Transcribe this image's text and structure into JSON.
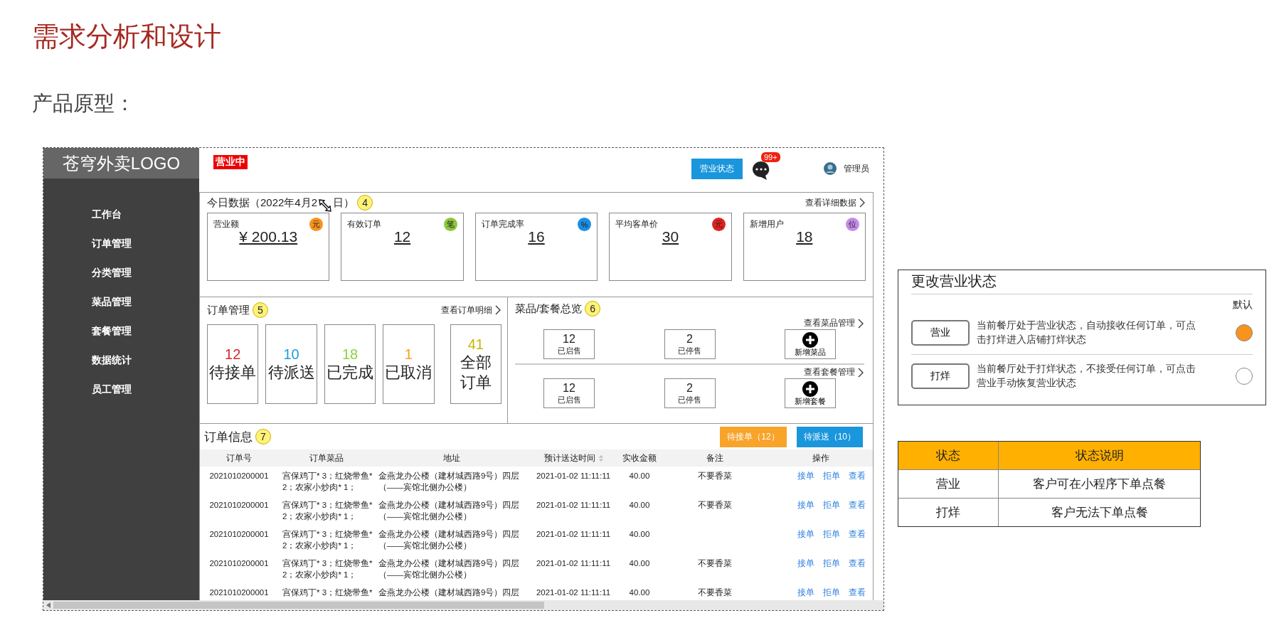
{
  "page_title": "需求分析和设计",
  "subtitle": "产品原型：",
  "prototype": {
    "logo": "苍穹外卖LOGO",
    "sidebar": {
      "items": [
        "工作台",
        "订单管理",
        "分类管理",
        "菜品管理",
        "套餐管理",
        "数据统计",
        "员工管理"
      ]
    },
    "header": {
      "status_badge": "营业中",
      "status_button": "营业状态",
      "message_count": "99+",
      "user": "管理员"
    },
    "today_data": {
      "title_start": "今日数据（2022年4月2",
      "title_end": "日）",
      "badge": "4",
      "link": "查看详细数据",
      "cards": [
        {
          "label": "营业额",
          "value": "¥ 200.13",
          "icon": "元",
          "color": "#f7931e"
        },
        {
          "label": "有效订单",
          "value": "12",
          "icon": "笔",
          "color": "#8cc63f"
        },
        {
          "label": "订单完成率",
          "value": "16",
          "icon": "%",
          "color": "#1a8fe3"
        },
        {
          "label": "平均客单价",
          "value": "30",
          "icon": "元",
          "color": "#e02020"
        },
        {
          "label": "新增用户",
          "value": "18",
          "icon": "位",
          "color": "#c58be8"
        }
      ]
    },
    "order_management": {
      "title": "订单管理",
      "badge": "5",
      "link": "查看订单明细",
      "statuses": [
        {
          "count": "12",
          "label": "待接单",
          "color": "#d9262c"
        },
        {
          "count": "10",
          "label": "待派送",
          "color": "#1a9ae0"
        },
        {
          "count": "18",
          "label": "已完成",
          "color": "#8cd23c"
        },
        {
          "count": "1",
          "label": "已取消",
          "color": "#f7a11a"
        },
        {
          "count": "41",
          "label": "全部订单",
          "color": "#c8b400"
        }
      ]
    },
    "dish_overview": {
      "title": "菜品/套餐总览",
      "badge": "6",
      "groups": [
        {
          "link": "查看菜品管理",
          "stats": [
            {
              "count": "12",
              "label": "已启售"
            },
            {
              "count": "2",
              "label": "已停售"
            }
          ],
          "add_label": "新增菜品"
        },
        {
          "link": "查看套餐管理",
          "stats": [
            {
              "count": "12",
              "label": "已启售"
            },
            {
              "count": "2",
              "label": "已停售"
            }
          ],
          "add_label": "新增套餐"
        }
      ]
    },
    "order_info": {
      "title": "订单信息",
      "badge": "7",
      "buttons": [
        {
          "label": "待接单（12）",
          "kind": "warning"
        },
        {
          "label": "待派送（10）",
          "kind": "primary"
        }
      ],
      "table": {
        "columns": [
          {
            "label": "订单号",
            "sortable": false
          },
          {
            "label": "订单菜品",
            "sortable": false
          },
          {
            "label": "地址",
            "sortable": false
          },
          {
            "label": "预计送达时间",
            "sortable": true
          },
          {
            "label": "实收金额",
            "sortable": false
          },
          {
            "label": "备注",
            "sortable": false
          },
          {
            "label": "操作",
            "sortable": false
          }
        ],
        "rows": [
          {
            "order_no": "2021010200001",
            "dishes": "宫保鸡丁* 3；红烧带鱼* 2；农家小炒肉* 1；",
            "address": "金燕龙办公楼（建材城西路9号）四层（——宾馆北侧办公楼）",
            "time": "2021-01-02 11:11:11",
            "amount": "40.00",
            "remark": "不要香菜",
            "actions": [
              "接单",
              "拒单",
              "查看"
            ]
          },
          {
            "order_no": "2021010200001",
            "dishes": "宫保鸡丁* 3；红烧带鱼* 2；农家小炒肉* 1；",
            "address": "金燕龙办公楼（建材城西路9号）四层（——宾馆北侧办公楼）",
            "time": "2021-01-02 11:11:11",
            "amount": "40.00",
            "remark": "不要香菜",
            "actions": [
              "接单",
              "拒单",
              "查看"
            ]
          },
          {
            "order_no": "2021010200001",
            "dishes": "宫保鸡丁* 3；红烧带鱼* 2；农家小炒肉* 1；",
            "address": "金燕龙办公楼（建材城西路9号）四层（——宾馆北侧办公楼）",
            "time": "2021-01-02 11:11:11",
            "amount": "40.00",
            "actions": [
              "接单",
              "拒单",
              "查看"
            ]
          },
          {
            "order_no": "2021010200001",
            "dishes": "宫保鸡丁* 3；红烧带鱼* 2；农家小炒肉* 1；",
            "address": "金燕龙办公楼（建材城西路9号）四层（——宾馆北侧办公楼）",
            "time": "2021-01-02 11:11:11",
            "amount": "40.00",
            "remark": "不要香菜",
            "actions": [
              "接单",
              "拒单",
              "查看"
            ]
          },
          {
            "order_no": "2021010200001",
            "dishes": "宫保鸡丁* 3；红烧带鱼*",
            "address": "金燕龙办公楼（建材城西路9号）四层",
            "time": "2021-01-02 11:11:11",
            "amount": "40.00",
            "remark": "不要香菜",
            "actions": [
              "接单",
              "拒单",
              "查看"
            ]
          }
        ]
      }
    }
  },
  "business_status": {
    "title": "更改营业状态",
    "default_label": "默认",
    "options": [
      {
        "button": "营业",
        "description": "当前餐厅处于营业状态，自动接收任何订单，可点击打烊进入店铺打烊状态",
        "selected": true
      },
      {
        "button": "打烊",
        "description": "当前餐厅处于打烊状态，不接受任何订单，可点击营业手动恢复营业状态",
        "selected": false
      }
    ]
  },
  "status_table": {
    "columns": [
      "状态",
      "状态说明"
    ],
    "rows": [
      [
        "营业",
        "客户可在小程序下单点餐"
      ],
      [
        "打烊",
        "客户无法下单点餐"
      ]
    ]
  }
}
